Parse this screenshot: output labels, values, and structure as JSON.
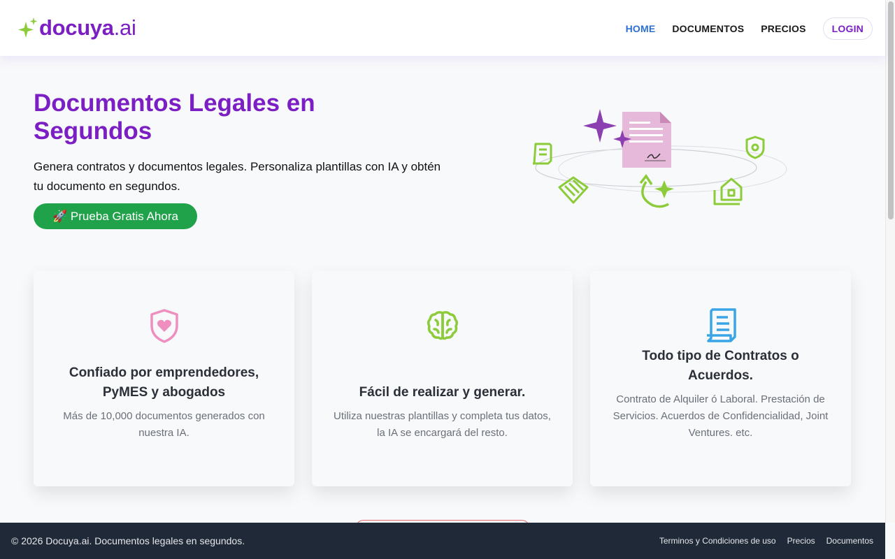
{
  "header": {
    "brand": "docuya",
    "brand_suffix": ".ai",
    "nav": [
      {
        "label": "HOME",
        "active": true
      },
      {
        "label": "DOCUMENTOS",
        "active": false
      },
      {
        "label": "PRECIOS",
        "active": false
      },
      {
        "label": "LOGIN",
        "active": false
      }
    ]
  },
  "hero": {
    "title": "Documentos Legales en Segundos",
    "subtitle": "Genera contratos y documentos legales. Personaliza plantillas con IA y obtén tu documento en segundos.",
    "cta": "🚀 Prueba Gratis Ahora"
  },
  "features": [
    {
      "icon": "shield-heart-icon",
      "title": "Confiado por emprendedores, PyMES y abogados",
      "text": "Más de 10,000 documentos generados con nuestra IA.",
      "icon_color": "#ee8fc0"
    },
    {
      "icon": "brain-icon",
      "title": "Fácil de realizar y generar.",
      "text": "Utiliza nuestras plantillas y completa tus datos, la IA se encargará del resto.",
      "icon_color": "#8ccc3a"
    },
    {
      "icon": "scroll-document-icon",
      "title": "Todo tipo de Contratos o Acuerdos.",
      "text": "Contrato de Alquiler ó Laboral. Prestación de Servicios. Acuerdos de Confidencialidad, Joint Ventures. etc.",
      "icon_color": "#3aa5e6"
    }
  ],
  "footer": {
    "copyright": "© 2026 Docuya.ai. Documentos legales en segundos.",
    "links": [
      "Terminos y Condiciones de uso",
      "Precios",
      "Documentos"
    ]
  },
  "colors": {
    "brand_purple": "#7b1fc4",
    "nav_active": "#2b6fd6",
    "cta_green": "#1fa24a",
    "footer_bg": "#1f2937",
    "accent_green": "#8ccc3a"
  }
}
